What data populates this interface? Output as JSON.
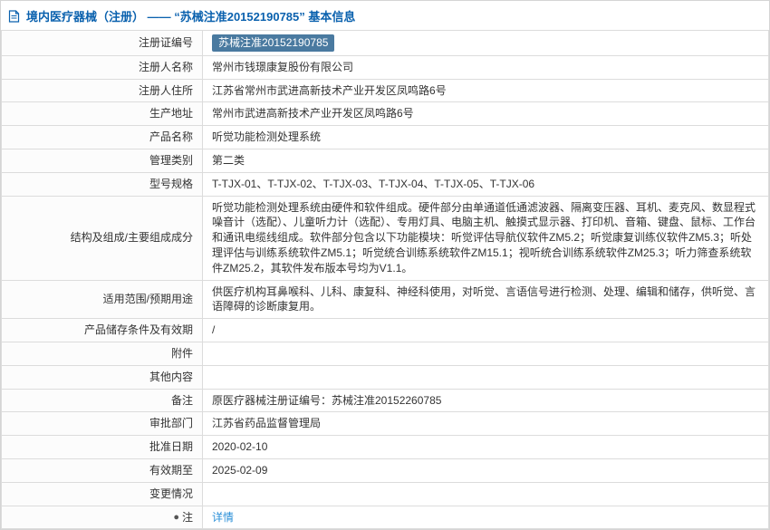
{
  "header": {
    "title": "境内医疗器械（注册） —— “苏械注准20152190785” 基本信息"
  },
  "icons": {
    "document": "document-icon",
    "note": "note-icon"
  },
  "colors": {
    "title_blue": "#0a61ae",
    "badge_bg": "#4a7aa0",
    "link_blue": "#2a8fd8",
    "border": "#dcdcdc"
  },
  "table": {
    "rows": [
      {
        "label": "注册证编号",
        "value": "苏械注准20152190785"
      },
      {
        "label": "注册人名称",
        "value": "常州市钱璟康复股份有限公司"
      },
      {
        "label": "注册人住所",
        "value": "江苏省常州市武进高新技术产业开发区凤鸣路6号"
      },
      {
        "label": "生产地址",
        "value": "常州市武进高新技术产业开发区凤鸣路6号"
      },
      {
        "label": "产品名称",
        "value": "听觉功能检测处理系统"
      },
      {
        "label": "管理类别",
        "value": "第二类"
      },
      {
        "label": "型号规格",
        "value": "T-TJX-01、T-TJX-02、T-TJX-03、T-TJX-04、T-TJX-05、T-TJX-06"
      },
      {
        "label": "结构及组成/主要组成成分",
        "value": "听觉功能检测处理系统由硬件和软件组成。硬件部分由单通道低通滤波器、隔离变压器、耳机、麦克风、数显程式噪音计（选配）、儿童听力计（选配）、专用灯具、电脑主机、触摸式显示器、打印机、音箱、键盘、鼠标、工作台和通讯电缆线组成。软件部分包含以下功能模块：听觉评估导航仪软件ZM5.2；听觉康复训练仪软件ZM5.3；听处理评估与训练系统软件ZM5.1；听觉统合训练系统软件ZM15.1；视听统合训练系统软件ZM25.3；听力筛查系统软件ZM25.2，其软件发布版本号均为V1.1。"
      },
      {
        "label": "适用范围/预期用途",
        "value": "供医疗机构耳鼻喉科、儿科、康复科、神经科使用，对听觉、言语信号进行检测、处理、编辑和储存，供听觉、言语障碍的诊断康复用。"
      },
      {
        "label": "产品储存条件及有效期",
        "value": "/"
      },
      {
        "label": "附件",
        "value": ""
      },
      {
        "label": "其他内容",
        "value": ""
      },
      {
        "label": "备注",
        "value": "原医疗器械注册证编号：苏械注准20152260785"
      },
      {
        "label": "审批部门",
        "value": "江苏省药品监督管理局"
      },
      {
        "label": "批准日期",
        "value": "2020-02-10"
      },
      {
        "label": "有效期至",
        "value": "2025-02-09"
      },
      {
        "label": "变更情况",
        "value": ""
      },
      {
        "label": "注",
        "value": "详情"
      }
    ]
  }
}
